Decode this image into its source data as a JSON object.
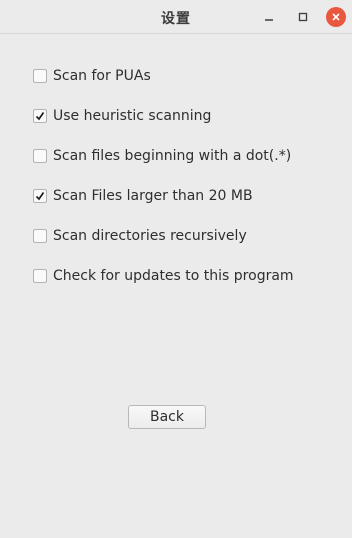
{
  "window": {
    "title": "设置",
    "close_color": "#e9573f"
  },
  "options": [
    {
      "label": "Scan for PUAs",
      "checked": false
    },
    {
      "label": "Use heuristic scanning",
      "checked": true
    },
    {
      "label": "Scan files beginning with a dot(.*)",
      "checked": false
    },
    {
      "label": "Scan Files larger than 20 MB",
      "checked": true
    },
    {
      "label": "Scan directories recursively",
      "checked": false
    },
    {
      "label": "Check for updates to this program",
      "checked": false
    }
  ],
  "buttons": {
    "back_label": "Back"
  }
}
